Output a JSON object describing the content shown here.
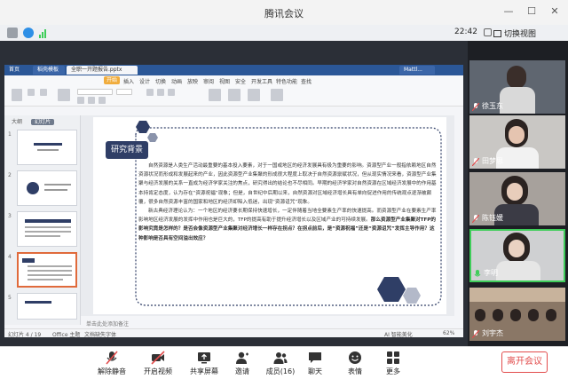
{
  "window": {
    "title": "腾讯会议"
  },
  "toolbar": {
    "timer": "22:42",
    "switch_view": "切换视图"
  },
  "app": {
    "tabs": [
      "首页",
      "稻壳模板",
      "全职一开题报告.pptx",
      "Mattl..."
    ],
    "menu": [
      "开始",
      "插入",
      "设计",
      "切换",
      "动画",
      "放映",
      "审阅",
      "视图",
      "安全",
      "开发工具",
      "特色功能",
      "查找"
    ],
    "active_menu": "开始",
    "thumb_header": [
      "大纲",
      "幻灯片"
    ],
    "slide_numbers": [
      "1",
      "2",
      "3",
      "4",
      "5"
    ],
    "notes_placeholder": "单击此处添加备注",
    "status": {
      "slide": "幻灯片 4 / 19",
      "theme": "Office 主题",
      "missing_font": "文档缺失字体",
      "ai": "AI 智能美化",
      "zoom": "62%"
    }
  },
  "slide": {
    "title": "研究背景",
    "para1": "自然资源是人类生产活动最重要的基本投入要素，对于一国或地区的经济发展具有极为重要的影响。资源型产业一般指依赖地区自然资源状况而形成和发展起来的产业，因此资源型产业集聚的形成很大程度上取决于自然资源禀赋状况，但从现实情况来看，资源型产业集聚与经济发展的关系一直成为经济学家关注的焦点，研究得出的结论也不尽相同。早期的经济学家对自然资源在区域经济发展中的作用基本持肯定态度，认为存在“资源祝福”现象；但是，自世纪中后期以来，自然资源对区域经济增长具有单向促进作用的传统观点逐渐被颠覆，很多自然资源丰富的国家和地区的经济却陷入低迷，出现“资源诅咒”现象。",
    "para2a": "新古典经济理论认为：一个地区的经济要长期保持快速增长，一定伴随着当地全要素生产率的快速提高。而资源型产业在要素生产率影响地区经济发展的发挥中作用也是巨大的，TFP的提高有助于提升经济增长以及区域产业的可持续发展。",
    "para2b": "那么资源型产业集聚对TFP的影响究竟是怎样的？是否会像资源型产业集聚对经济增长一样存在拐点？在拐点前后，是“资源祝福”还是“资源诅咒”发挥主导作用？这种影响是否具有空间溢出效应？"
  },
  "participants": [
    {
      "name": "徐玉东",
      "muted": true
    },
    {
      "name": "田梦思",
      "muted": true
    },
    {
      "name": "陈钰媛",
      "muted": true
    },
    {
      "name": "李明",
      "muted": false
    },
    {
      "name": "刘宇杰",
      "muted": true
    }
  ],
  "controls": [
    {
      "label": "解除静音",
      "icon": "mic-off-icon"
    },
    {
      "label": "开启视频",
      "icon": "camera-icon"
    },
    {
      "label": "共享屏幕",
      "icon": "share-screen-icon"
    },
    {
      "label": "邀请",
      "icon": "invite-icon"
    },
    {
      "label": "成员(16)",
      "icon": "members-icon"
    },
    {
      "label": "聊天",
      "icon": "chat-icon"
    },
    {
      "label": "表情",
      "icon": "emoji-icon"
    },
    {
      "label": "更多",
      "icon": "more-icon"
    }
  ],
  "leave_label": "离开会议",
  "colors": {
    "accent_green": "#3fcd5a",
    "leave_red": "#e24c4c",
    "slide_navy": "#2f3e66",
    "wps_blue": "#2b5797"
  }
}
